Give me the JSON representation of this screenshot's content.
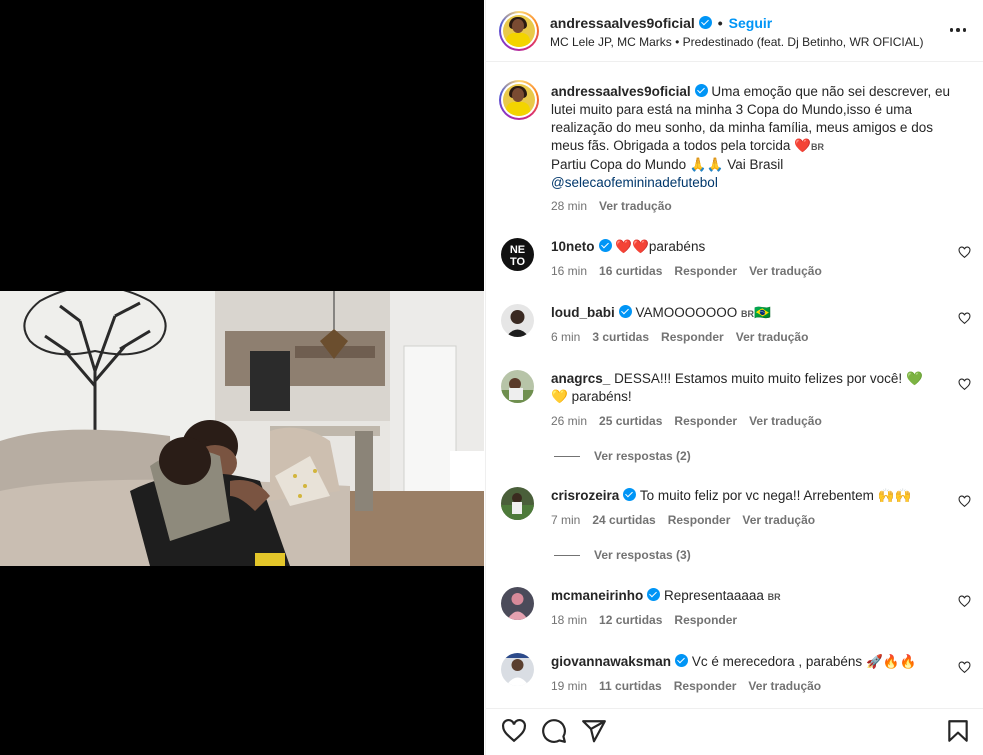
{
  "header": {
    "username": "andressaalves9oficial",
    "separator": "•",
    "follow_label": "Seguir",
    "audio": "MC Lele JP, MC Marks • Predestinado (feat. Dj Betinho, WR OFICIAL)"
  },
  "caption": {
    "username": "andressaalves9oficial",
    "line1": "Uma emoção que não sei descrever, eu lutei muito para está na minha 3 Copa do Mundo,isso é uma realização do meu sonho, da minha família, meus amigos e dos meus fãs. Obrigada a todos pela torcida",
    "flag": "BR",
    "line2": "Partiu Copa do Mundo 🙏🙏 Vai Brasil",
    "mention": "@selecaofemininadefutebol",
    "time": "28 min",
    "translate": "Ver tradução"
  },
  "comments": [
    {
      "username": "10neto",
      "text": "parabéns",
      "time": "16 min",
      "likes": "16 curtidas",
      "reply": "Responder",
      "translate": "Ver tradução"
    },
    {
      "username": "loud_babi",
      "text": "VAMOOOOOOO",
      "flag": "BR",
      "extra": "🇧🇷",
      "time": "6 min",
      "likes": "3 curtidas",
      "reply": "Responder",
      "translate": "Ver tradução"
    },
    {
      "username": "anagrcs_",
      "text": "DESSA!!! Estamos muito muito felizes por você!",
      "text2": "parabéns!",
      "time": "26 min",
      "likes": "25 curtidas",
      "reply": "Responder",
      "translate": "Ver tradução",
      "replies": "Ver respostas (2)"
    },
    {
      "username": "crisrozeira",
      "text": "To muito feliz por vc nega!! Arrebentem",
      "extra": "🙌🙌",
      "time": "7 min",
      "likes": "24 curtidas",
      "reply": "Responder",
      "translate": "Ver tradução",
      "replies": "Ver respostas (3)"
    },
    {
      "username": "mcmaneirinho",
      "text": "Representaaaaa",
      "flag": "BR",
      "time": "18 min",
      "likes": "12 curtidas",
      "reply": "Responder"
    },
    {
      "username": "giovannawaksman",
      "text": "Vc é merecedora , parabéns",
      "extra": "🚀🔥🔥",
      "time": "19 min",
      "likes": "11 curtidas",
      "reply": "Responder",
      "translate": "Ver tradução"
    }
  ],
  "icons": {
    "like": "heart-icon",
    "comment": "comment-icon",
    "share": "paper-plane-icon",
    "save": "bookmark-icon"
  },
  "colors": {
    "accent": "#0095f6",
    "verified": "#0095f6",
    "text": "#262626",
    "muted": "#737373"
  }
}
